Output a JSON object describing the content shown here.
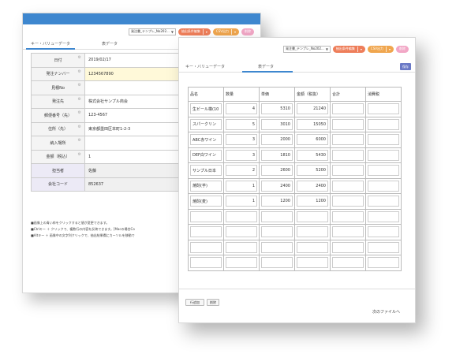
{
  "toolbar": {
    "template_select": "発注書_テンプレ_No202...",
    "extract_button": "抽出条件編集",
    "csv_button": "CSV出力",
    "delete_button": "削除"
  },
  "tabs": {
    "key_value": "キー・バリューデータ",
    "table": "表データ"
  },
  "save_label": "保存",
  "form_rows": [
    {
      "label": "日付",
      "value": "2019/02/17"
    },
    {
      "label": "発注ナンバー",
      "value": "1234567890"
    },
    {
      "label": "見積No",
      "value": ""
    },
    {
      "label": "発注先",
      "value": "株式会社サンプル商会"
    },
    {
      "label": "郵便番号（先）",
      "value": "123-4567"
    },
    {
      "label": "住所（先）",
      "value": "東京都墨田区本町1-2-3"
    },
    {
      "label": "納入場所",
      "value": ""
    },
    {
      "label": "金額（税込）",
      "value": "1"
    },
    {
      "label": "担当者",
      "value": "佐藤"
    },
    {
      "label": "会社コード",
      "value": "852637"
    }
  ],
  "notes": [
    "■画像上の青い枠をクリックすると値が変更できます。",
    "■Ctrlキー ＋ クリックで、複数行の内容を反映できます。[Macの場合Co",
    "■Altキー ＋ 画像中の文字列クリックで、抽出結果欄にカーソルを移動で"
  ],
  "grid": {
    "headers": [
      "品名",
      "数量",
      "単価",
      "金額（税抜）",
      "合計",
      "消費税"
    ],
    "rows": [
      [
        "生ビール樽(10",
        "4",
        "5310",
        "21240",
        "",
        ""
      ],
      [
        "スパークリン",
        "5",
        "3010",
        "15050",
        "",
        ""
      ],
      [
        "ABC赤ワイン",
        "3",
        "2000",
        "6000",
        "",
        ""
      ],
      [
        "DEF白ワイン",
        "3",
        "1810",
        "5430",
        "",
        ""
      ],
      [
        "サンプル日本",
        "2",
        "2600",
        "5200",
        "",
        ""
      ],
      [
        "焼酎(芋)",
        "1",
        "2400",
        "2400",
        "",
        ""
      ],
      [
        "焼酎(麦)",
        "1",
        "1200",
        "1200",
        "",
        ""
      ],
      [
        "",
        "",
        "",
        "",
        "",
        ""
      ],
      [
        "",
        "",
        "",
        "",
        "",
        ""
      ],
      [
        "",
        "",
        "",
        "",
        "",
        ""
      ],
      [
        "",
        "",
        "",
        "",
        "",
        ""
      ]
    ]
  },
  "bottom": {
    "add_row": "行追加",
    "delete": "削除",
    "next_file": "次のファイルへ"
  }
}
